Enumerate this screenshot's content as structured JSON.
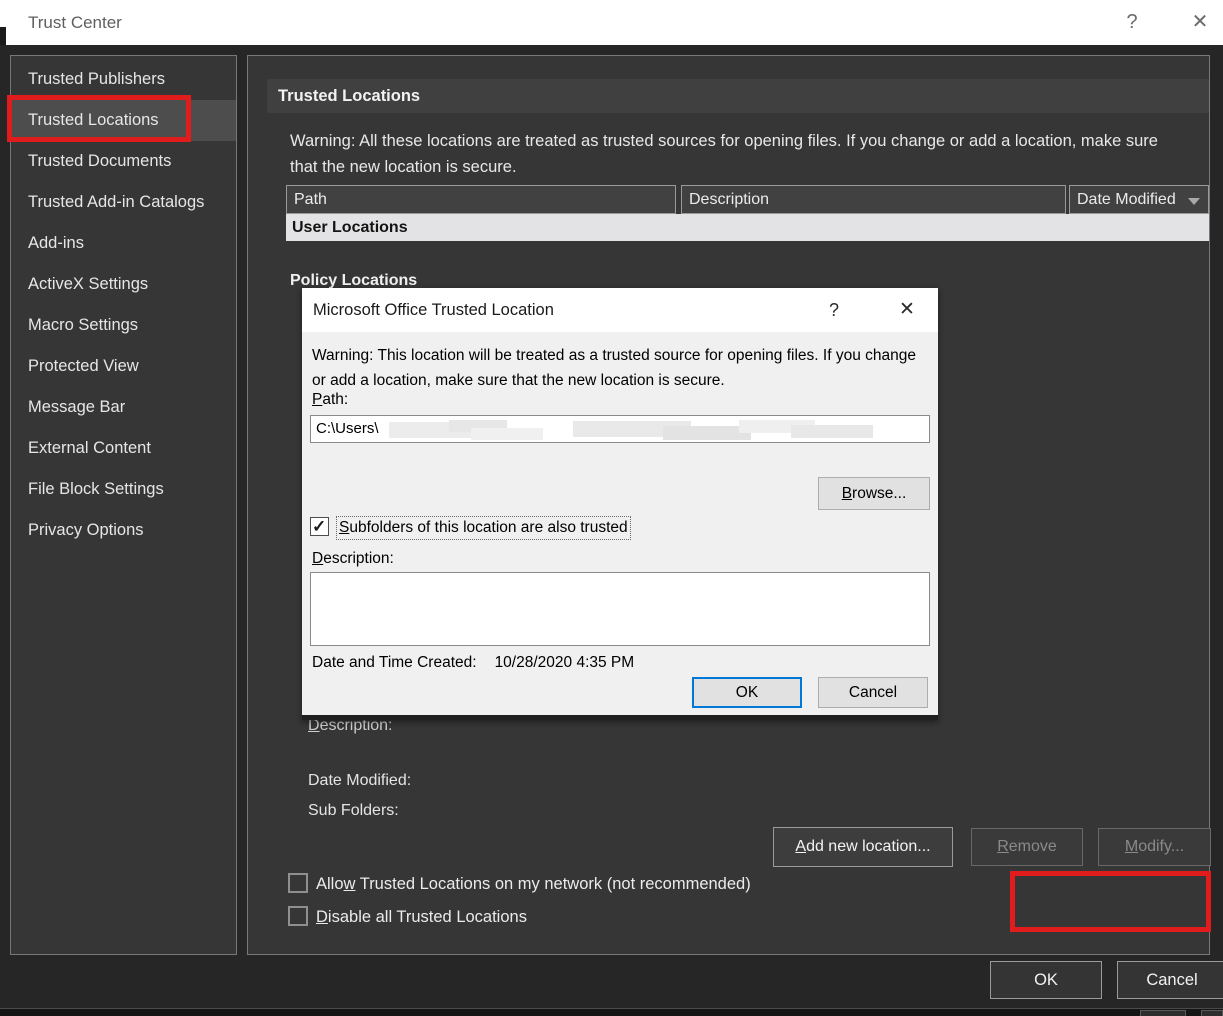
{
  "window": {
    "title": "Trust Center",
    "help_icon": "?",
    "close_icon": "✕",
    "ok_label": "OK",
    "cancel_label": "Cancel"
  },
  "sidebar": {
    "items": [
      {
        "label": "Trusted Publishers",
        "selected": false
      },
      {
        "label": "Trusted Locations",
        "selected": true,
        "annotated": true
      },
      {
        "label": "Trusted Documents",
        "selected": false
      },
      {
        "label": "Trusted Add-in Catalogs",
        "selected": false
      },
      {
        "label": "Add-ins",
        "selected": false
      },
      {
        "label": "ActiveX Settings",
        "selected": false
      },
      {
        "label": "Macro Settings",
        "selected": false
      },
      {
        "label": "Protected View",
        "selected": false
      },
      {
        "label": "Message Bar",
        "selected": false
      },
      {
        "label": "External Content",
        "selected": false
      },
      {
        "label": "File Block Settings",
        "selected": false
      },
      {
        "label": "Privacy Options",
        "selected": false
      }
    ]
  },
  "main": {
    "header": "Trusted Locations",
    "warning": "Warning: All these locations are treated as trusted sources for opening files.  If you change or add a location, make sure that the new location is secure.",
    "table": {
      "columns": {
        "path": "Path",
        "description": "Description",
        "date_modified": "Date Modified"
      },
      "sorted_by": "Date Modified",
      "group_user": "User Locations",
      "group_policy": "Policy Locations"
    },
    "details": {
      "description_label": "Description:",
      "date_modified_label": "Date Modified:",
      "sub_folders_label": "Sub Folders:"
    },
    "buttons": {
      "add": "Add new location...",
      "remove": "Remove",
      "modify": "Modify..."
    },
    "checkboxes": {
      "allow_network": {
        "label": "Allow Trusted Locations on my network (not recommended)",
        "checked": false
      },
      "disable_all": {
        "label": "Disable all Trusted Locations",
        "checked": false
      }
    }
  },
  "dialog": {
    "title": "Microsoft Office Trusted Location",
    "help_icon": "?",
    "close_icon": "✕",
    "warning": "Warning: This location will be treated as a trusted source for opening files. If you change or add a location, make sure that the new location is secure.",
    "path_label": "Path:",
    "path_value": "C:\\Users\\",
    "path_redacted": true,
    "browse_label": "Browse...",
    "subfolders": {
      "label": "Subfolders of this location are also trusted",
      "checked": true
    },
    "description_label": "Description:",
    "description_value": "",
    "created_label": "Date and Time Created:",
    "created_value": "10/28/2020 4:35 PM",
    "ok_label": "OK",
    "cancel_label": "Cancel"
  },
  "colors": {
    "annotation_red": "#e11c1c",
    "accent_blue": "#0078d7",
    "panel_bg": "#363636",
    "titlebar_bg": "#ffffff"
  }
}
